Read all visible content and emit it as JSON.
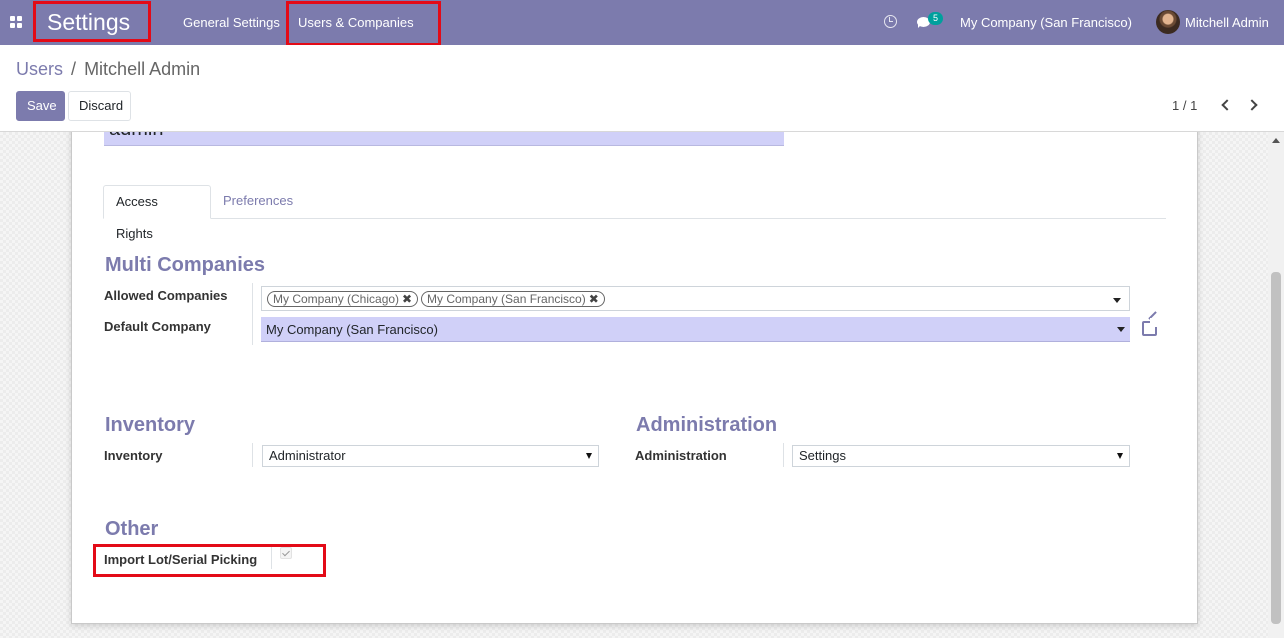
{
  "navbar": {
    "brand": "Settings",
    "menu": [
      "General Settings",
      "Users & Companies"
    ],
    "notification_count": "5",
    "company": "My Company (San Francisco)",
    "user": "Mitchell Admin",
    "background_color": "#7c7bad"
  },
  "control_panel": {
    "breadcrumb": {
      "parent": "Users",
      "separator": "/",
      "current": "Mitchell Admin"
    },
    "save_label": "Save",
    "discard_label": "Discard",
    "pager": "1 / 1"
  },
  "form": {
    "login_value": "admin",
    "tabs": [
      "Access Rights",
      "Preferences"
    ],
    "multi_companies": {
      "title": "Multi Companies",
      "allowed_label": "Allowed Companies",
      "allowed_tags": [
        "My Company (Chicago)",
        "My Company (San Francisco)"
      ],
      "default_label": "Default Company",
      "default_value": "My Company (San Francisco)"
    },
    "inventory": {
      "title": "Inventory",
      "label": "Inventory",
      "value": "Administrator"
    },
    "administration": {
      "title": "Administration",
      "label": "Administration",
      "value": "Settings"
    },
    "other": {
      "title": "Other",
      "import_label": "Import Lot/Serial Picking",
      "import_checked": true
    }
  },
  "highlight_color": "#e30a17",
  "accent_color": "#7c7bad"
}
